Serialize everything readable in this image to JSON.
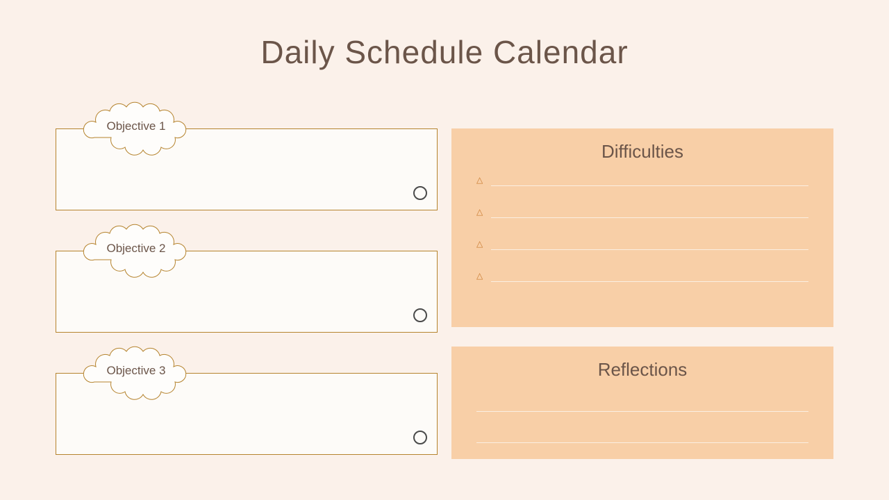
{
  "title": "Daily Schedule Calendar",
  "objectives": [
    {
      "label": "Objective 1"
    },
    {
      "label": "Objective 2"
    },
    {
      "label": "Objective 3"
    }
  ],
  "difficulties": {
    "title": "Difficulties",
    "rows": 4
  },
  "reflections": {
    "title": "Reflections",
    "rows": 2
  },
  "colors": {
    "background": "#FBF1EA",
    "panel": "#F8CFA7",
    "text": "#6B5549",
    "border": "#B5832D"
  }
}
